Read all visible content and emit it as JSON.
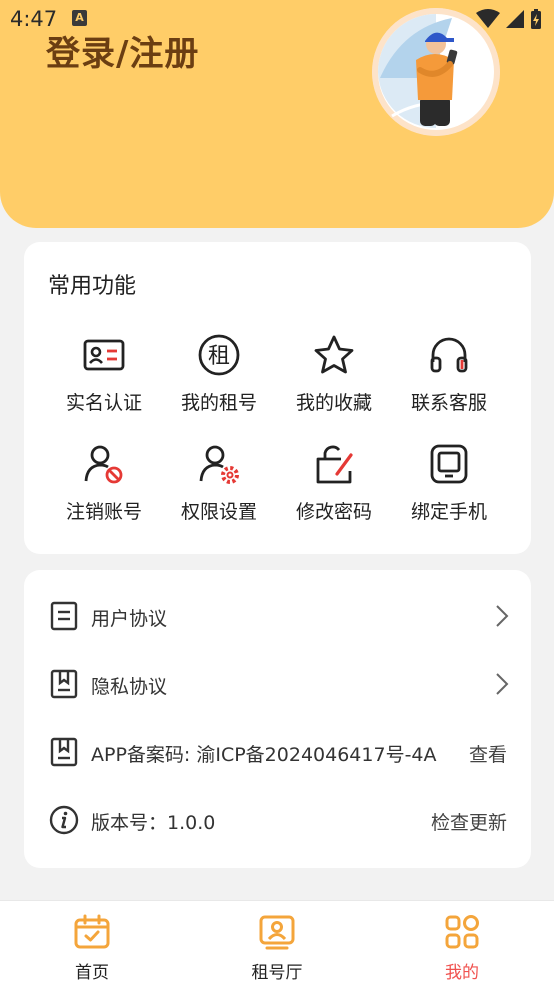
{
  "status_bar": {
    "time": "4:47",
    "notification_badge": "A"
  },
  "header": {
    "title": "登录/注册"
  },
  "features": {
    "title": "常用功能",
    "items": [
      {
        "label": "实名认证",
        "icon": "id-card-icon"
      },
      {
        "label": "我的租号",
        "icon": "rent-icon"
      },
      {
        "label": "我的收藏",
        "icon": "star-icon"
      },
      {
        "label": "联系客服",
        "icon": "headset-icon"
      },
      {
        "label": "注销账号",
        "icon": "user-cancel-icon"
      },
      {
        "label": "权限设置",
        "icon": "user-gear-icon"
      },
      {
        "label": "修改密码",
        "icon": "lock-edit-icon"
      },
      {
        "label": "绑定手机",
        "icon": "phone-icon"
      }
    ]
  },
  "list": [
    {
      "label": "用户协议",
      "icon": "document-icon",
      "action": ""
    },
    {
      "label": "隐私协议",
      "icon": "bookmark-doc-icon",
      "action": ""
    },
    {
      "label": "APP备案码: 渝ICP备2024046417号-4A",
      "icon": "bookmark-doc-icon",
      "action": "查看"
    },
    {
      "label": "版本号：1.0.0",
      "icon": "info-icon",
      "action": "检查更新"
    }
  ],
  "tabbar": {
    "tabs": [
      {
        "label": "首页",
        "icon": "calendar-check-icon"
      },
      {
        "label": "租号厅",
        "icon": "profile-card-icon"
      },
      {
        "label": "我的",
        "icon": "grid-apps-icon",
        "active": true
      }
    ]
  },
  "colors": {
    "accent": "#ffcd68",
    "active_tab": "#f0524f",
    "title_brown": "#6b3e12",
    "icon_orange": "#f4a53b",
    "warn_red": "#e53935"
  }
}
